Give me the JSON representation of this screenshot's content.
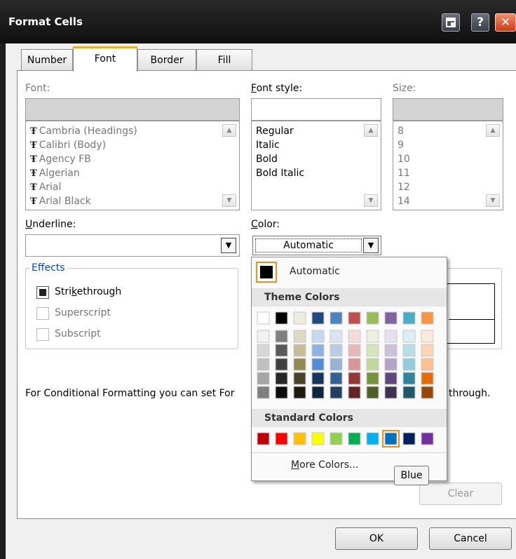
{
  "window": {
    "title": "Format Cells"
  },
  "titlebar_buttons": {
    "help": "?",
    "close": "✕"
  },
  "tabs": [
    {
      "label": "Number",
      "active": false
    },
    {
      "label": "Font",
      "active": true
    },
    {
      "label": "Border",
      "active": false
    },
    {
      "label": "Fill",
      "active": false
    }
  ],
  "font": {
    "label": "Font:",
    "items": [
      "Cambria (Headings)",
      "Calibri (Body)",
      "Agency FB",
      "Algerian",
      "Arial",
      "Arial Black"
    ]
  },
  "font_style": {
    "label_pre": "",
    "label_u": "F",
    "label_post": "ont style:",
    "items": [
      "Regular",
      "Italic",
      "Bold",
      "Bold Italic"
    ]
  },
  "size": {
    "label": "Size:",
    "items": [
      "8",
      "9",
      "10",
      "11",
      "12",
      "14"
    ]
  },
  "underline": {
    "label_u": "U",
    "label_post": "nderline:",
    "value": ""
  },
  "color": {
    "label_u": "C",
    "label_post": "olor:",
    "value": "Automatic"
  },
  "effects": {
    "legend": "Effects",
    "strikethrough": {
      "pre": "Stri",
      "u": "k",
      "post": "ethrough",
      "checked": true
    },
    "superscript": {
      "label": "Superscript",
      "checked": false
    },
    "subscript": {
      "label": "Subscript",
      "checked": false
    }
  },
  "info_text": {
    "left": "For Conditional Formatting you can set For",
    "right": "through."
  },
  "buttons": {
    "clear": "Clear",
    "ok": "OK",
    "cancel": "Cancel"
  },
  "color_picker": {
    "automatic_label": "Automatic",
    "theme_header": "Theme Colors",
    "standard_header": "Standard Colors",
    "more_colors_u": "M",
    "more_colors_post": "ore Colors...",
    "theme_top": [
      "#ffffff",
      "#000000",
      "#eeece1",
      "#1f497d",
      "#4f81bd",
      "#c0504d",
      "#9bbb59",
      "#8064a2",
      "#4bacc6",
      "#f79646"
    ],
    "theme_shades": [
      [
        "#f2f2f2",
        "#d8d8d8",
        "#bfbfbf",
        "#a5a5a5",
        "#7f7f7f"
      ],
      [
        "#7f7f7f",
        "#595959",
        "#3f3f3f",
        "#262626",
        "#0c0c0c"
      ],
      [
        "#ddd9c3",
        "#c4bd97",
        "#938953",
        "#494429",
        "#1d1b10"
      ],
      [
        "#c6d9f0",
        "#8db3e2",
        "#548dd4",
        "#17365d",
        "#0f243e"
      ],
      [
        "#dbe5f1",
        "#b8cce4",
        "#95b3d7",
        "#366092",
        "#244061"
      ],
      [
        "#f2dcdb",
        "#e5b9b7",
        "#d99694",
        "#953734",
        "#632423"
      ],
      [
        "#ebf1dd",
        "#d7e3bc",
        "#c3d69b",
        "#76923c",
        "#4f6128"
      ],
      [
        "#e5e0ec",
        "#ccc1d9",
        "#b2a2c7",
        "#5f497a",
        "#3f3151"
      ],
      [
        "#dbeef3",
        "#b7dde8",
        "#92cddc",
        "#31859b",
        "#205867"
      ],
      [
        "#fdeada",
        "#fbd5b5",
        "#fac08f",
        "#e36c09",
        "#974806"
      ]
    ],
    "standard": [
      "#c00000",
      "#ff0000",
      "#ffc000",
      "#ffff00",
      "#92d050",
      "#00b050",
      "#00b0f0",
      "#0070c0",
      "#002060",
      "#7030a0"
    ],
    "selected_standard_index": 7,
    "tooltip": "Blue"
  }
}
